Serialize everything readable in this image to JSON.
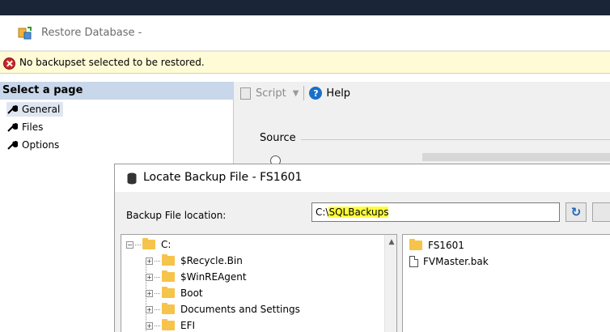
{
  "window": {
    "title": "Restore Database -",
    "colors": {
      "title_strip": "#1b2538",
      "error_bg": "#fffbd6",
      "page_header_bg": "#c8d7ea",
      "highlight": "#ffff3a",
      "folder": "#f6c34b"
    }
  },
  "error": {
    "icon": "error-x-icon",
    "message": "No backupset selected to be restored."
  },
  "pages": {
    "header": "Select a page",
    "items": [
      {
        "label": "General",
        "icon": "wrench-icon",
        "selected": true
      },
      {
        "label": "Files",
        "icon": "wrench-icon",
        "selected": false
      },
      {
        "label": "Options",
        "icon": "wrench-icon",
        "selected": false
      }
    ]
  },
  "toolbar": {
    "script_label": "Script",
    "help_label": "Help"
  },
  "source": {
    "label": "Source"
  },
  "dialog": {
    "title": "Locate Backup File - FS1601",
    "location_label": "Backup File location:",
    "location_value_prefix": "C:\\",
    "location_value_highlight": "SQLBackups",
    "refresh_icon": "refresh-icon",
    "tree": {
      "root": "C:",
      "children": [
        "$Recycle.Bin",
        "$WinREAgent",
        "Boot",
        "Documents and Settings",
        "EFI"
      ]
    },
    "files": [
      {
        "name": "FS1601",
        "icon": "folder-icon"
      },
      {
        "name": "FVMaster.bak",
        "icon": "file-icon"
      }
    ]
  }
}
